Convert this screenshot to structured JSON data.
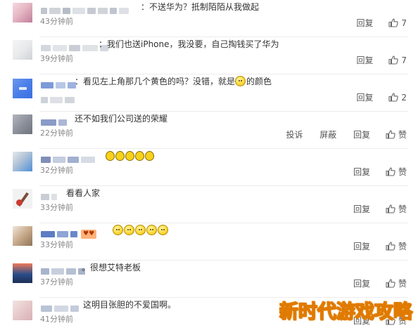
{
  "colors": {
    "text": "#333333",
    "time": "#888888",
    "action": "#555555",
    "separator": "#ececec",
    "watermark": "#e07a00"
  },
  "comments": [
    {
      "content": "：不送华为？抵制陌陌从我做起",
      "time": "43分钟前",
      "actions": [
        "回复"
      ],
      "likes": "7",
      "avatar_colors": [
        "#e6b7c4",
        "#c07e9a",
        "#f4d8e0"
      ],
      "name_blocks": [
        "#bfc5cf",
        "#d0d4da",
        "#b7bdc7",
        "#dde1e6",
        "#c5cad2"
      ]
    },
    {
      "content": "：我们也送iPhone，我没要，自己掏钱买了华为",
      "time": "39分钟前",
      "actions": [
        "回复"
      ],
      "likes": "7",
      "avatar_colors": [
        "#e9eaec",
        "#cfd2d6",
        "#f4f5f6"
      ],
      "name_blocks": [
        "#d4d8de",
        "#e1e4e8",
        "#c9ced6",
        "#dfe2e6"
      ]
    },
    {
      "content": "：看见左上角那几个黄色的吗？没错，就是",
      "content_after": "的颜色",
      "time": "",
      "actions": [
        "回复"
      ],
      "likes": "2",
      "avatar_colors": [
        "#4b7fe8",
        "#3a6fe0",
        "#6b97ef"
      ],
      "name_blocks": [
        "#7c9bd8",
        "#b7c7e6",
        "#9db2dd"
      ]
    },
    {
      "content": "还不如我们公司送的荣耀",
      "time": "22分钟前",
      "actions": [
        "投诉",
        "屏蔽",
        "回复"
      ],
      "likes": "赞",
      "avatar_colors": [
        "#8a8e99",
        "#b3b6bd",
        "#6f737d"
      ],
      "name_blocks": [
        "#8a9bc8",
        "#aab7d6"
      ]
    },
    {
      "content": "",
      "lemons": 5,
      "time": "32分钟前",
      "actions": [
        "回复"
      ],
      "likes": "赞",
      "avatar_colors": [
        "#4f8fd6",
        "#e5e8ec",
        "#b6c6d8"
      ],
      "name_blocks": [
        "#7f8fb8",
        "#c5cde0",
        "#a2b0cf",
        "#d6dbe5"
      ]
    },
    {
      "content": "看看人家",
      "time": "33分钟前",
      "actions": [
        "回复"
      ],
      "likes": "赞",
      "avatar_colors": [
        "#f2f2f2",
        "#7d4b3a",
        "#c93c2f"
      ],
      "name_blocks": [
        "#c9cdd4",
        "#dde0e4"
      ]
    },
    {
      "content": "",
      "emojis": 5,
      "time": "33分钟前",
      "actions": [
        "回复"
      ],
      "likes": "赞",
      "avatar_colors": [
        "#c7a98a",
        "#f0e6da",
        "#8f745a"
      ],
      "name_blocks": [
        "#5d7dc4",
        "#8ea5d6",
        "#6a88c9"
      ]
    },
    {
      "content": "。很想艾特老板",
      "time": "37分钟前",
      "actions": [
        "回复"
      ],
      "likes": "赞",
      "avatar_colors": [
        "#2b4d8a",
        "#ef7a5a",
        "#1d2f55"
      ],
      "name_blocks": [
        "#a8b4cc",
        "#c7cfdd",
        "#b6c0d3"
      ]
    },
    {
      "content": "这明目张胆的不爱国啊。",
      "time": "41分钟前",
      "actions": [
        "回复"
      ],
      "likes": "赞",
      "avatar_colors": [
        "#e7c9c9",
        "#d8b0b5",
        "#f3e2e2"
      ],
      "name_blocks": [
        "#b9c3d6",
        "#d2d8e3",
        "#c3cbdb"
      ]
    }
  ],
  "watermark": "新时代游戏攻略"
}
